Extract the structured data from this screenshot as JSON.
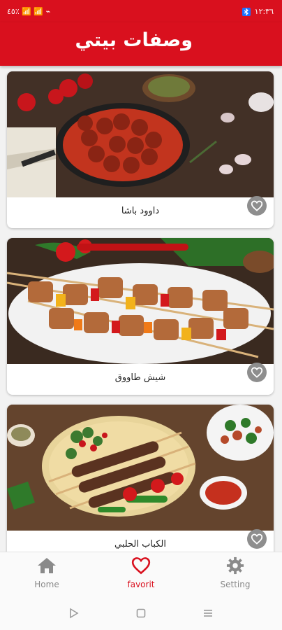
{
  "status": {
    "left_text": "٤٥٪ 📶 📶 ⌁",
    "time": "١٢:٣٦"
  },
  "app": {
    "title": "وصفات بيتي"
  },
  "recipes": [
    {
      "name": "داوود باشا"
    },
    {
      "name": "شيش طاووق"
    },
    {
      "name": "الكباب الحلبي"
    }
  ],
  "nav": {
    "home": "Home",
    "favorit": "favorit",
    "setting": "Setting"
  },
  "colors": {
    "accent": "#d9101e",
    "inactive": "#8a8a8a"
  }
}
